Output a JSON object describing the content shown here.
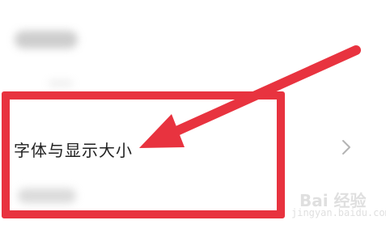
{
  "settings": {
    "font_size_item": {
      "label": "字体与显示大小",
      "chevron_icon": "chevron-right-icon"
    }
  },
  "annotation": {
    "highlight_color": "#e8333f",
    "arrow_icon": "arrow-pointing-left-icon"
  },
  "watermark": {
    "brand": "Bai 经验",
    "url": "jingyan.baidu.com"
  }
}
